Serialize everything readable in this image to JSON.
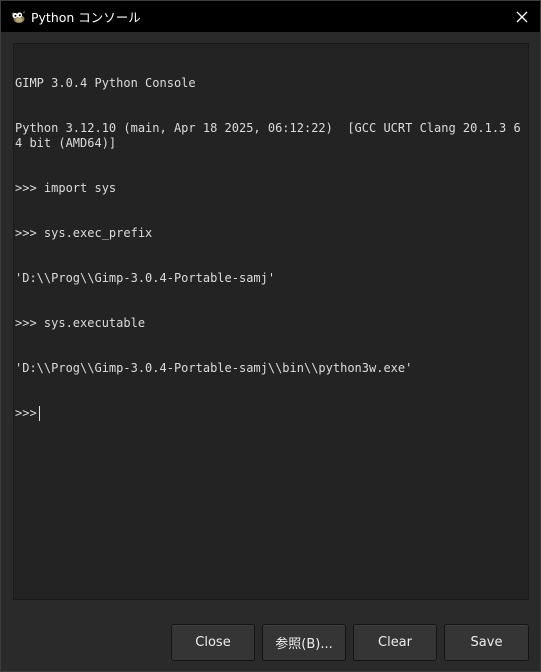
{
  "window": {
    "title": "Python コンソール",
    "app_icon": "gimp-wilber-icon",
    "close_icon": "close-icon"
  },
  "console": {
    "lines": [
      "GIMP 3.0.4 Python Console",
      "Python 3.12.10 (main, Apr 18 2025, 06:12:22)  [GCC UCRT Clang 20.1.3 64 bit (AMD64)]",
      ">>> import sys",
      ">>> sys.exec_prefix",
      "'D:\\\\Prog\\\\Gimp-3.0.4-Portable-samj'",
      ">>> sys.executable",
      "'D:\\\\Prog\\\\Gimp-3.0.4-Portable-samj\\\\bin\\\\python3w.exe'"
    ],
    "prompt": ">>>"
  },
  "buttons": {
    "close": "Close",
    "browse": "参照(B)...",
    "clear": "Clear",
    "save": "Save"
  },
  "colors": {
    "titlebar": "#000000",
    "window_bg": "#2a2a2a",
    "console_bg": "#232323",
    "console_text": "#dcdcdc",
    "button_bg": "#353535"
  }
}
